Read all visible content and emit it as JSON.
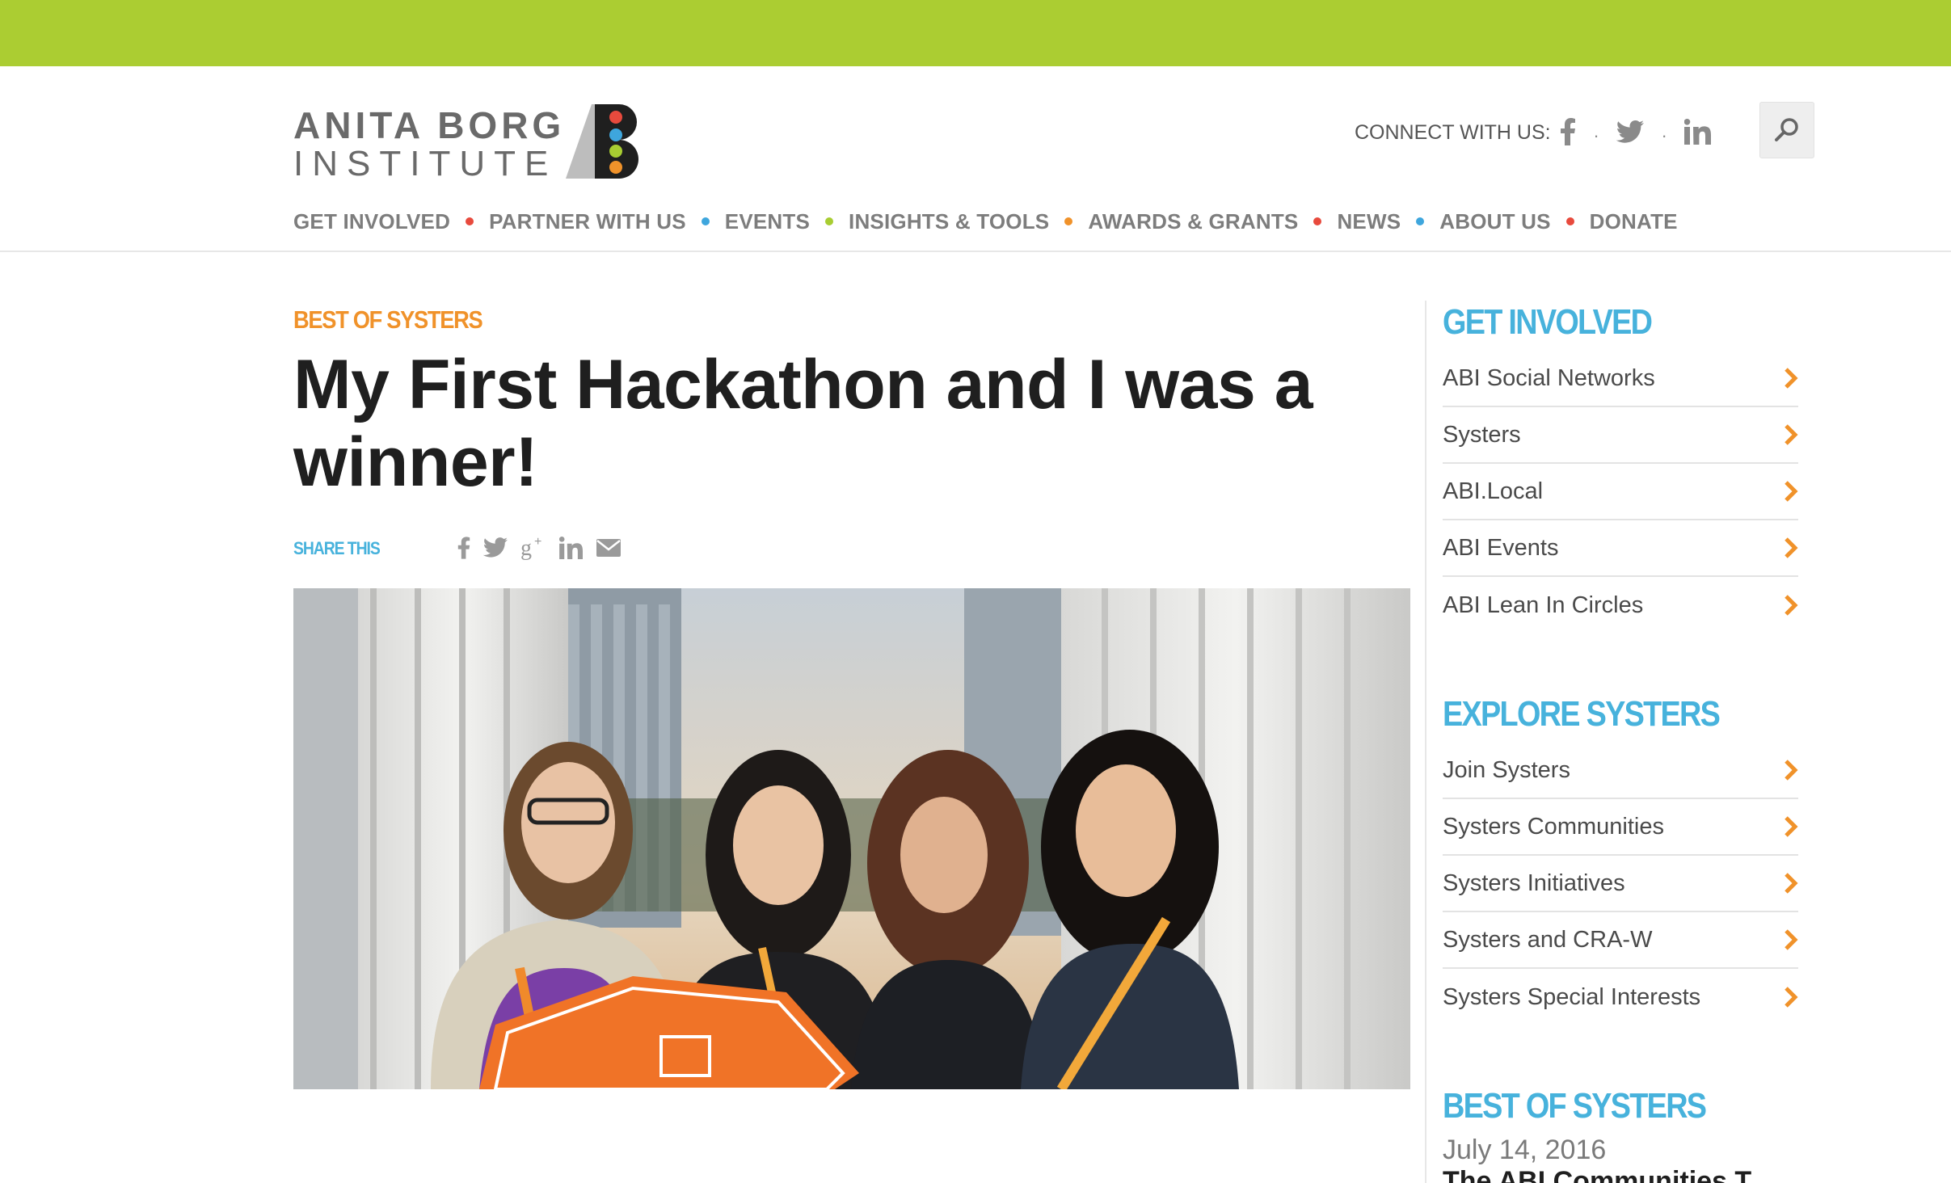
{
  "brand": {
    "name_line1": "ANITA BORG",
    "name_line2": "INSTITUTE",
    "logo_letters": "AB",
    "logo_dot_colors": [
      "#e84a3d",
      "#3ea6dd",
      "#a8cd32",
      "#f0922a"
    ]
  },
  "header": {
    "connect_label": "CONNECT WITH US:",
    "social_icons": [
      "facebook-icon",
      "twitter-icon",
      "linkedin-icon"
    ],
    "separator": "."
  },
  "nav": {
    "items": [
      {
        "label": "GET INVOLVED",
        "dot": "#e84a3d"
      },
      {
        "label": "PARTNER WITH US",
        "dot": "#3ea6dd"
      },
      {
        "label": "EVENTS",
        "dot": "#a8cd32"
      },
      {
        "label": "INSIGHTS & TOOLS",
        "dot": "#f0922a"
      },
      {
        "label": "AWARDS & GRANTS",
        "dot": "#e84a3d"
      },
      {
        "label": "NEWS",
        "dot": "#3ea6dd"
      },
      {
        "label": "ABOUT US",
        "dot": "#e84a3d"
      },
      {
        "label": "DONATE",
        "dot": null
      }
    ]
  },
  "article": {
    "category": "BEST OF SYSTERS",
    "title": "My First Hackathon and I was a winner!",
    "share_label": "SHARE THIS",
    "share_icons": [
      "facebook-icon",
      "twitter-icon",
      "google-plus-icon",
      "linkedin-icon",
      "email-icon"
    ]
  },
  "sidebar": {
    "sections": [
      {
        "heading": "GET INVOLVED",
        "items": [
          "ABI Social Networks",
          "Systers",
          "ABI.Local",
          "ABI Events",
          "ABI Lean In Circles"
        ]
      },
      {
        "heading": "EXPLORE SYSTERS",
        "items": [
          "Join Systers",
          "Systers Communities",
          "Systers Initiatives",
          "Systers and CRA-W",
          "Systers Special Interests"
        ]
      }
    ],
    "best_of": {
      "heading": "BEST OF SYSTERS",
      "date": "July 14, 2016",
      "teaser": "The ABI Communities T..."
    }
  },
  "colors": {
    "top_bar": "#abcd32",
    "accent_orange": "#f0922a",
    "accent_blue": "#47b2dc"
  }
}
